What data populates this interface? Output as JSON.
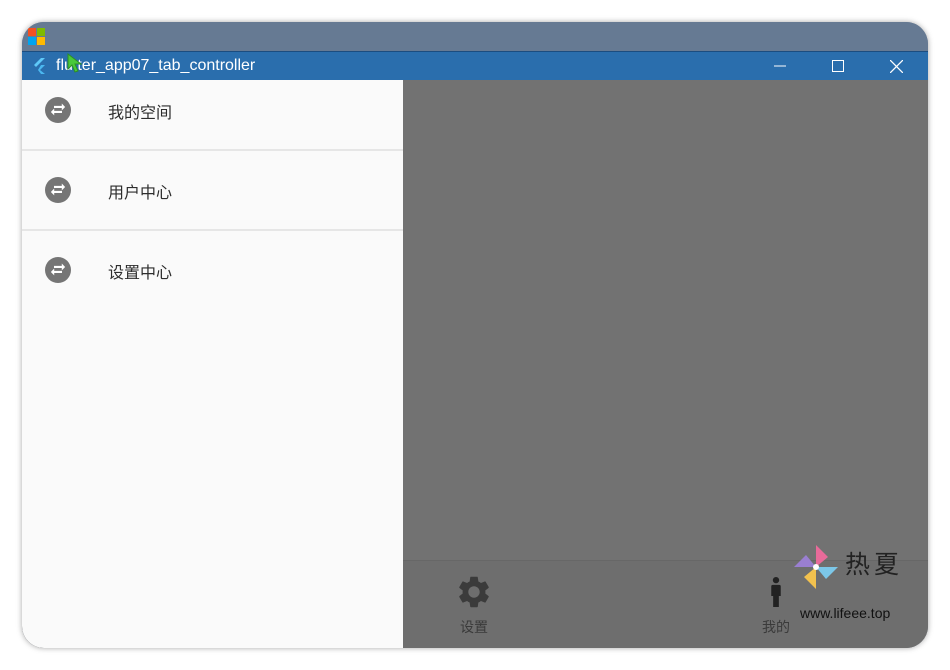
{
  "window": {
    "title": "flutter_app07_tab_controller"
  },
  "drawer": {
    "items": [
      {
        "label": "我的空间",
        "icon": "swap-circle-icon"
      },
      {
        "label": "用户中心",
        "icon": "swap-circle-icon"
      },
      {
        "label": "设置中心",
        "icon": "swap-circle-icon"
      }
    ]
  },
  "bottom_nav": {
    "items": [
      {
        "label": "设置",
        "icon": "gear-icon"
      },
      {
        "label": "我的",
        "icon": "person-icon"
      }
    ]
  },
  "watermark": {
    "title": "热夏",
    "url": "www.lifeee.top"
  },
  "colors": {
    "titlebar": "#2a6ead",
    "scrim": "#727272",
    "drawer_bg": "#fafafa",
    "icon_gray": "#757575"
  }
}
